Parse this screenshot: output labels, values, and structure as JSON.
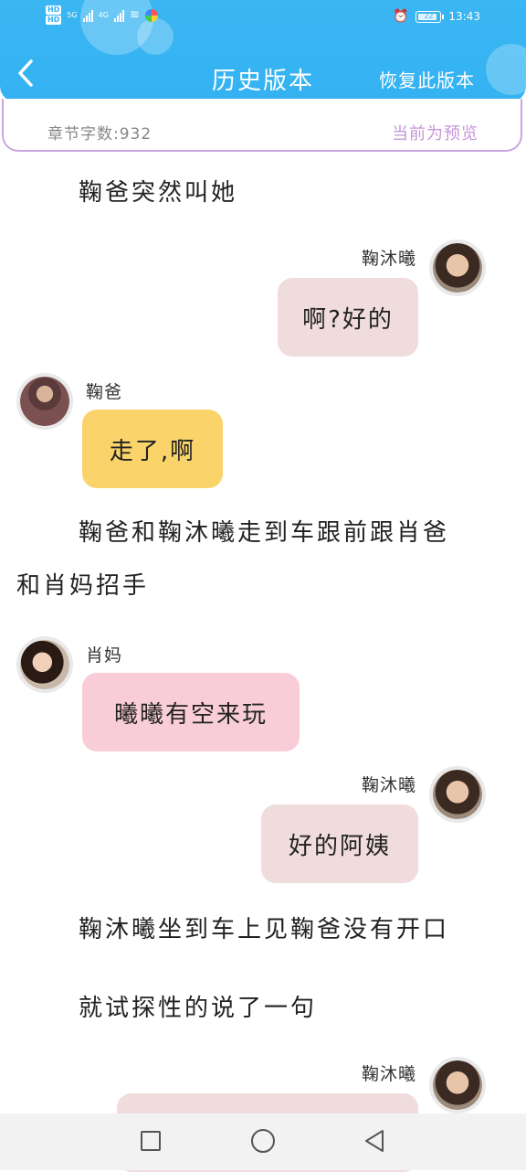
{
  "status_bar": {
    "net1": "HD",
    "net2": "HD",
    "gen1": "5G",
    "gen2": "4G",
    "battery": "22",
    "time": "13:43"
  },
  "header": {
    "title": "历史版本",
    "restore_label": "恢复此版本",
    "back_icon": "chevron-left-icon"
  },
  "info": {
    "word_count": "章节字数:932",
    "preview_label": "当前为预览"
  },
  "story": {
    "narr1": "鞠爸突然叫她",
    "msg1": {
      "name": "鞠沐曦",
      "text": "啊?好的"
    },
    "msg2": {
      "name": "鞠爸",
      "text": "走了,啊"
    },
    "narr2_line1": "鞠爸和鞠沐曦走到车跟前跟肖爸",
    "narr2_line2": "和肖妈招手",
    "msg3": {
      "name": "肖妈",
      "text": "曦曦有空来玩"
    },
    "msg4": {
      "name": "鞠沐曦",
      "text": "好的阿姨"
    },
    "narr3": "鞠沐曦坐到车上见鞠爸没有开口",
    "narr4": "就试探性的说了一句",
    "msg5": {
      "name": "鞠沐曦",
      "text": ""
    }
  },
  "colors": {
    "header_blue": "#34b2f2",
    "bubble_pink_grey": "#f0dcdc",
    "bubble_yellow": "#fad46a",
    "bubble_pink": "#f9cdd8",
    "info_border": "#c9a8e0",
    "preview_purple": "#c796d9"
  },
  "navbar": {
    "icons": [
      "recent-apps-icon",
      "home-icon",
      "back-icon"
    ]
  }
}
